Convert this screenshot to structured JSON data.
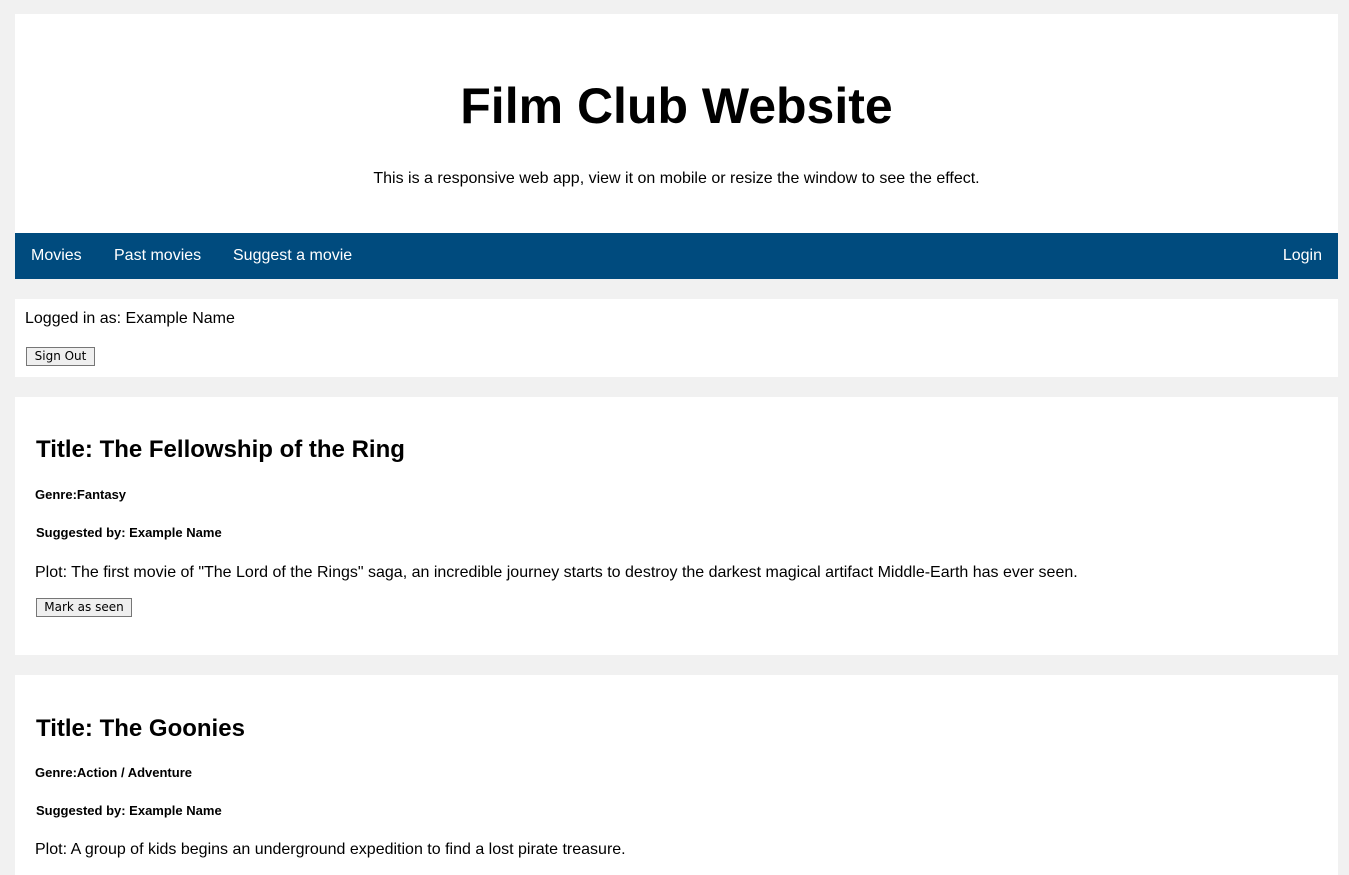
{
  "header": {
    "title": "Film Club Website",
    "subtitle": "This is a responsive web app, view it on mobile or resize the window to see the effect."
  },
  "nav": {
    "items": [
      {
        "label": "Movies"
      },
      {
        "label": "Past movies"
      },
      {
        "label": "Suggest a movie"
      }
    ],
    "login_label": "Login"
  },
  "account": {
    "logged_in_text": "Logged in as: Example Name",
    "sign_out_label": "Sign Out"
  },
  "movies": [
    {
      "title": "Title: The Fellowship of the Ring",
      "genre": "Genre:Fantasy",
      "suggested_by": "Suggested by: Example Name",
      "plot": "Plot: The first movie of \"The Lord of the Rings\" saga, an incredible journey starts to destroy the darkest magical artifact Middle-Earth has ever seen.",
      "mark_seen_label": "Mark as seen"
    },
    {
      "title": "Title: The Goonies",
      "genre": "Genre:Action / Adventure",
      "suggested_by": "Suggested by: Example Name",
      "plot": "Plot: A group of kids begins an underground expedition to find a lost pirate treasure."
    }
  ],
  "colors": {
    "background": "#f1f1f1",
    "nav_bar": "#004b7e",
    "card": "#ffffff"
  }
}
